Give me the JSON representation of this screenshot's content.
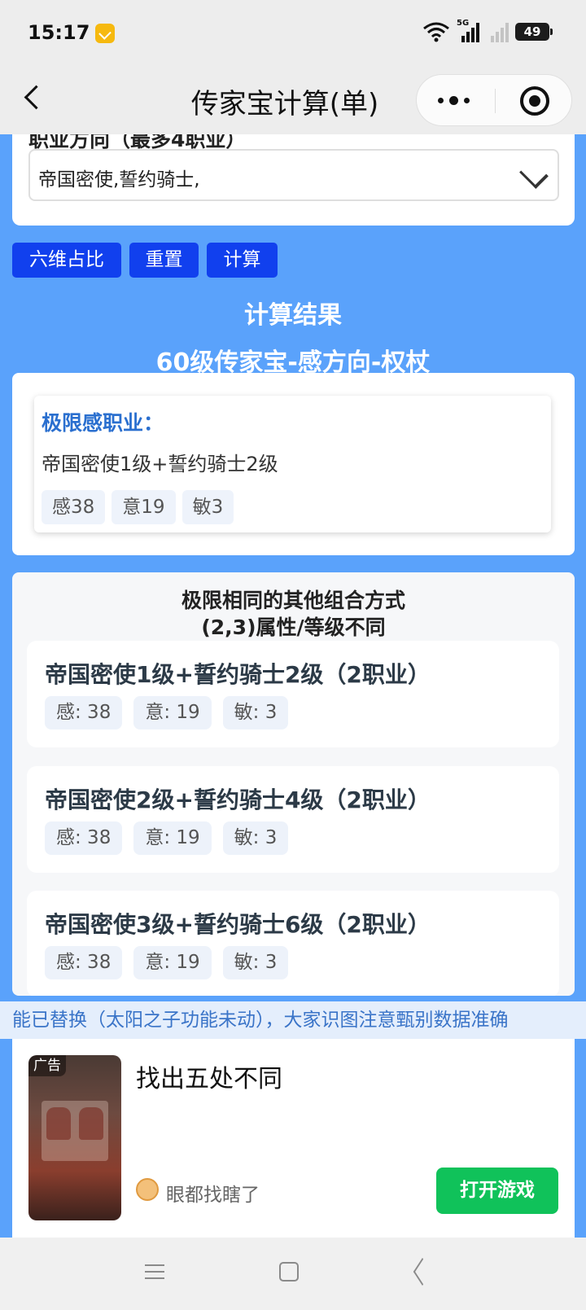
{
  "status_bar": {
    "time": "15:17",
    "network": "5G",
    "battery": "49"
  },
  "nav": {
    "title": "传家宝计算(单)"
  },
  "career": {
    "label": "职业方向（最多4职业）",
    "selected": "帝国密使,誓约骑士,"
  },
  "buttons": {
    "ratio": "六维占比",
    "reset": "重置",
    "calculate": "计算"
  },
  "result": {
    "title": "计算结果",
    "subtitle": "60级传家宝-感方向-权杖",
    "limit": {
      "heading": "极限感职业：",
      "combo": "帝国密使1级+誓约骑士2级",
      "tags": [
        "感38",
        "意19",
        "敏3"
      ]
    }
  },
  "combos": {
    "title_line1": "极限相同的其他组合方式",
    "title_line2": "(2,3)属性/等级不同",
    "items": [
      {
        "name": "帝国密使1级+誓约骑士2级（2职业）",
        "tags": [
          "感: 38",
          "意: 19",
          "敏: 3"
        ]
      },
      {
        "name": "帝国密使2级+誓约骑士4级（2职业）",
        "tags": [
          "感: 38",
          "意: 19",
          "敏: 3"
        ]
      },
      {
        "name": "帝国密使3级+誓约骑士6级（2职业）",
        "tags": [
          "感: 38",
          "意: 19",
          "敏: 3"
        ]
      }
    ]
  },
  "notice": "能已替换（太阳之子功能未动），大家识图注意甄别数据准确",
  "ad": {
    "label": "广告",
    "title": "找出五处不同",
    "source": "眼都找瞎了",
    "button": "打开游戏"
  }
}
